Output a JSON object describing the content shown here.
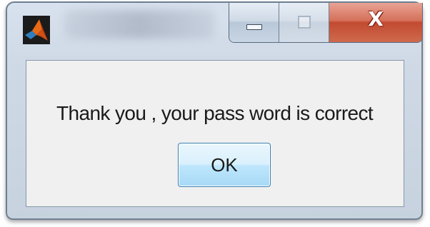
{
  "window": {
    "title_icon": "matlab-logo-icon",
    "controls": {
      "minimize_icon": "minimize-icon",
      "maximize_icon": "maximize-icon",
      "close_icon": "close-icon",
      "close_glyph": "X"
    }
  },
  "dialog": {
    "message": "Thank you , your pass word is correct",
    "ok_label": "OK"
  },
  "colors": {
    "close_button": "#c8553c",
    "ok_button_border": "#3c7fb1",
    "client_background": "#f0f0f0"
  }
}
